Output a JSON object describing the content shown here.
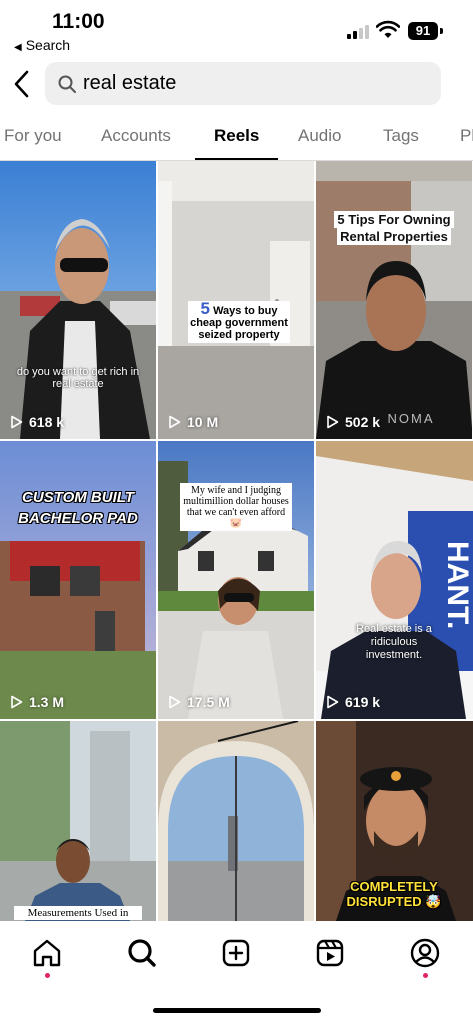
{
  "status_bar": {
    "time": "11:00",
    "back_app": "Search",
    "battery": "91"
  },
  "search": {
    "query": "real estate"
  },
  "tabs": [
    {
      "label": "For you"
    },
    {
      "label": "Accounts"
    },
    {
      "label": "Reels"
    },
    {
      "label": "Audio"
    },
    {
      "label": "Tags"
    },
    {
      "label": "Pl"
    }
  ],
  "reels": [
    {
      "views": "618 k",
      "caption": "do you want to get rich in real estate"
    },
    {
      "views": "10 M",
      "caption_num": "5",
      "caption": "Ways to buy cheap government seized property"
    },
    {
      "views": "502 k",
      "caption": "5 Tips For Owning Rental Properties",
      "shirt_text": "NOMA"
    },
    {
      "views": "1.3 M",
      "caption": "CUSTOM BUILT BACHELOR PAD"
    },
    {
      "views": "17.5 M",
      "caption": "My wife and I judging multimillion dollar houses that we can't even afford 🐷"
    },
    {
      "views": "619 k",
      "caption": "Real estate is a ridiculous investment.",
      "banner": "HANT."
    },
    {
      "views": "",
      "caption": "Measurements Used in"
    },
    {
      "views": "",
      "caption": ""
    },
    {
      "views": "",
      "caption": "COMPLETELY DISRUPTED 🤯"
    }
  ],
  "bottom_nav": [
    {
      "icon": "home-icon",
      "dot": true
    },
    {
      "icon": "search-icon",
      "dot": false
    },
    {
      "icon": "create-icon",
      "dot": false
    },
    {
      "icon": "reels-icon",
      "dot": false
    },
    {
      "icon": "profile-icon",
      "dot": true
    }
  ],
  "colors": {
    "notification_dot": "#e0245e",
    "search_bg": "#efefef",
    "inactive_tab": "#737373"
  }
}
